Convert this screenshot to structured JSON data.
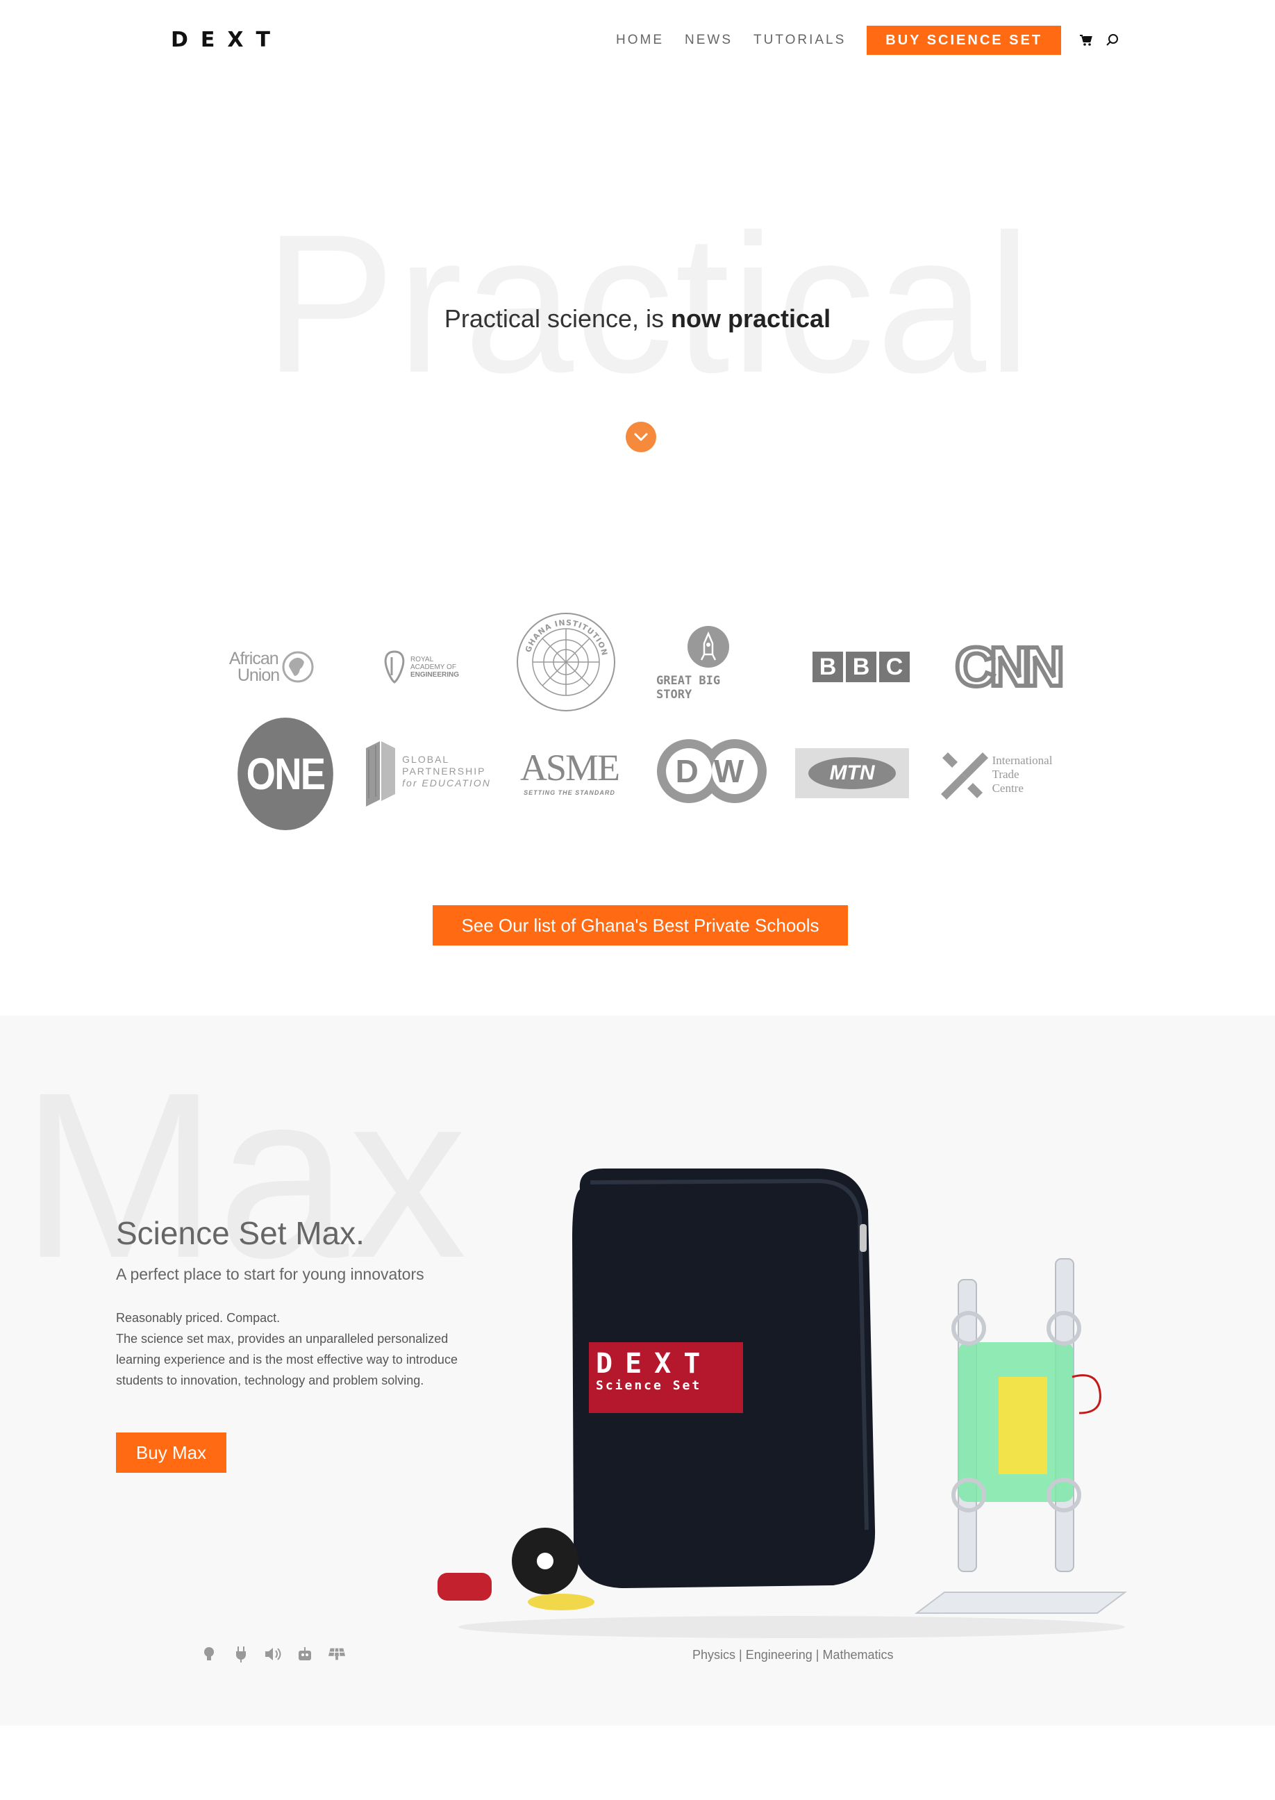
{
  "header": {
    "logo": "DEXT",
    "nav": [
      "HOME",
      "NEWS",
      "TUTORIALS"
    ],
    "buy_label": "BUY SCIENCE SET",
    "cart_icon": "cart-icon",
    "search_icon": "search-icon"
  },
  "hero": {
    "background_word": "Practical",
    "text_light": "Practical science, is ",
    "text_bold": "now practical",
    "arrow_icon": "chevron-down-icon",
    "accent": "#ff6a13"
  },
  "partners": {
    "african_union": [
      "African",
      "Union"
    ],
    "royal_academy": [
      "ROYAL",
      "ACADEMY OF",
      "ENGINEERING"
    ],
    "ghana_institution": "GHANA INSTITUTION OF ENGINEERS",
    "great_big_story": "GREAT BIG STORY",
    "bbc": [
      "B",
      "B",
      "C"
    ],
    "cnn": "CNN",
    "one": "ONE",
    "global_partnership": [
      "GLOBAL",
      "PARTNERSHIP",
      "for EDUCATION"
    ],
    "asme": "ASME",
    "asme_tag": "SETTING THE STANDARD",
    "dw": "DW",
    "mtn": "MTN",
    "itc": [
      "International",
      "Trade",
      "Centre"
    ]
  },
  "schools_button": "See Our list of Ghana's Best Private Schools",
  "max": {
    "background_word": "Max",
    "title": "Science Set Max.",
    "subtitle": "A perfect place to start for young innovators",
    "desc_line1": "Reasonably priced. Compact.",
    "desc_line2": "The science set max, provides an unparalleled personalized learning experience and is the most effective way to introduce students to innovation, technology and problem solving.",
    "button": "Buy Max",
    "bag_label_top": "DEXT",
    "bag_label_bottom": "Science Set",
    "feature_icons": [
      "lightbulb-icon",
      "plug-icon",
      "speaker-icon",
      "robot-icon",
      "solar-panel-icon"
    ],
    "subjects": "Physics | Engineering | Mathematics"
  }
}
